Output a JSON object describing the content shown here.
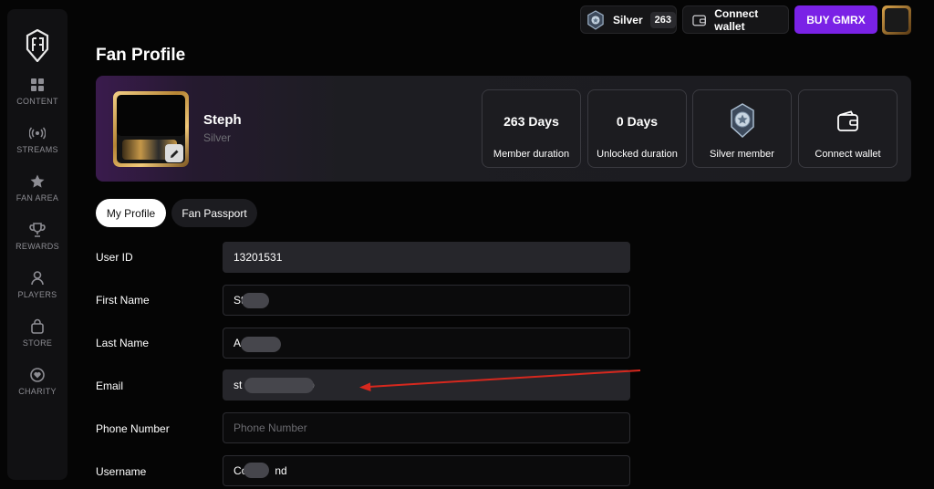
{
  "sidebar": {
    "items": [
      {
        "label": "CONTENT",
        "icon": "grid-icon"
      },
      {
        "label": "STREAMS",
        "icon": "broadcast-icon"
      },
      {
        "label": "FAN AREA",
        "icon": "star-icon"
      },
      {
        "label": "REWARDS",
        "icon": "trophy-icon"
      },
      {
        "label": "PLAYERS",
        "icon": "user-icon"
      },
      {
        "label": "STORE",
        "icon": "shopping-bag-icon"
      },
      {
        "label": "CHARITY",
        "icon": "heart-circle-icon"
      }
    ]
  },
  "topbar": {
    "tier_name": "Silver",
    "tier_count": "263",
    "connect_wallet_label": "Connect wallet",
    "buy_label": "BUY GMRX"
  },
  "page": {
    "title": "Fan Profile"
  },
  "hero": {
    "name": "Steph",
    "tier": "Silver",
    "stats": [
      {
        "value": "263 Days",
        "label": "Member duration"
      },
      {
        "value": "0 Days",
        "label": "Unlocked duration"
      },
      {
        "label": "Silver member",
        "icon": "silver-badge-icon"
      },
      {
        "label": "Connect wallet",
        "icon": "wallet-icon"
      }
    ]
  },
  "tabs": [
    {
      "label": "My Profile",
      "active": true
    },
    {
      "label": "Fan Passport",
      "active": false
    }
  ],
  "form": {
    "fields": [
      {
        "label": "User ID",
        "value": "13201531",
        "placeholder": ""
      },
      {
        "label": "First Name",
        "value": "St",
        "placeholder": ""
      },
      {
        "label": "Last Name",
        "value": "A",
        "placeholder": ""
      },
      {
        "label": "Email",
        "value": "st                    .io",
        "placeholder": ""
      },
      {
        "label": "Phone Number",
        "value": "",
        "placeholder": "Phone Number"
      },
      {
        "label": "Username",
        "value": "Co         nd",
        "placeholder": ""
      }
    ]
  },
  "colors": {
    "accent": "#7a22e6",
    "background": "#050505",
    "panel": "#1c1c20",
    "annotation_arrow": "#d6281e"
  }
}
